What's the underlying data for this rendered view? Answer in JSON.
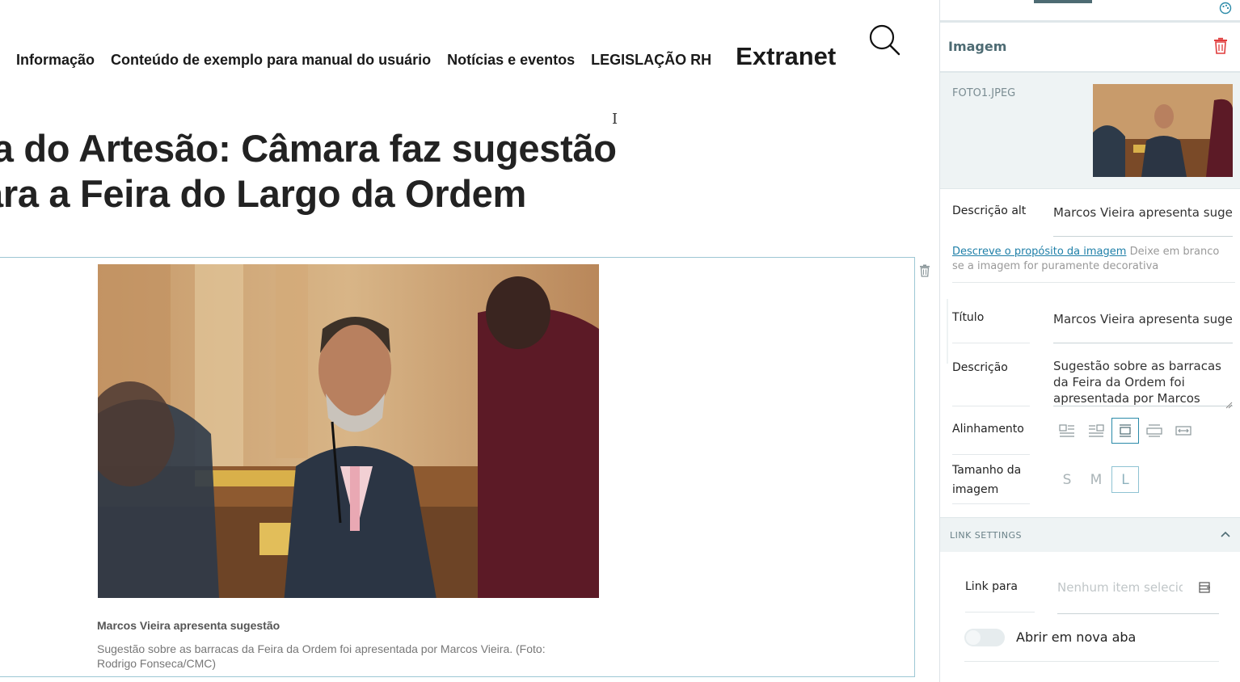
{
  "nav": {
    "items": [
      "Informação",
      "Conteúdo de exemplo para manual do usuário",
      "Notícias e eventos",
      "LEGISLAÇÃO RH"
    ],
    "extranet": "Extranet"
  },
  "article": {
    "title_line1": "ia do Artesão: Câmara faz sugestão",
    "title_line2": "ara a Feira do Largo da Ordem"
  },
  "figure": {
    "caption_title": "Marcos Vieira apresenta sugestão",
    "caption_text": "Sugestão sobre as barracas da Feira da Ordem foi apresentada por Marcos Vieira. (Foto: Rodrigo Fonseca/CMC)"
  },
  "sidebar": {
    "title": "Imagem",
    "file_name": "FOTO1.JPEG",
    "alt_label": "Descrição alt",
    "alt_value": "Marcos Vieira apresenta sugestão",
    "alt_help_link": "Descreve o propósito da imagem",
    "alt_help_text": "Deixe em branco se a imagem for puramente decorativa",
    "title_label": "Título",
    "title_value": "Marcos Vieira apresenta sugestão",
    "description_label": "Descrição",
    "description_value": "Sugestão sobre as barracas da Feira da Ordem foi apresentada por Marcos Vieira.",
    "alignment_label": "Alinhamento",
    "size_label_1": "Tamanho da",
    "size_label_2": "imagem",
    "sizes": [
      "S",
      "M",
      "L"
    ],
    "selected_size": "L",
    "link_settings_label": "LINK SETTINGS",
    "link_to_label": "Link para",
    "link_to_placeholder": "Nenhum item selecionado",
    "new_tab_label": "Abrir em nova aba",
    "new_tab_enabled": false
  },
  "colors": {
    "accent": "#4d6b73",
    "link": "#1e7fa8",
    "danger": "#e03c3c",
    "block_border": "#9dc7d4"
  }
}
